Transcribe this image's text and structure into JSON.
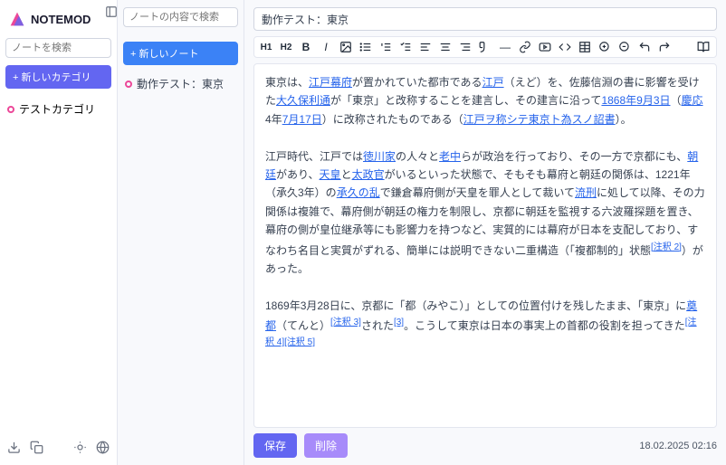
{
  "app": {
    "name": "NOTEMOD"
  },
  "sidebar": {
    "search_placeholder": "ノートを検索",
    "new_category": "+ 新しいカテゴリ",
    "categories": [
      {
        "label": "テストカテゴリ"
      }
    ]
  },
  "mid": {
    "search_placeholder": "ノートの内容で検索",
    "new_note": "+ 新しいノート",
    "notes": [
      {
        "label": "動作テスト：東京"
      }
    ]
  },
  "editor": {
    "title": "動作テスト：東京",
    "toolbar": {
      "h1": "H1",
      "h2": "H2"
    },
    "content_html": "東京は、<a href='#'>江戸幕府</a>が置かれていた都市である<a href='#'>江戸</a>（えど）を、佐藤信淵の書に影響を受けた<a href='#'>大久保利通</a>が「東京」と改称することを建言し、その建言に沿って<a href='#'>1868年</a><a href='#'>9月3日</a>（<a href='#'>慶応</a>4年<a href='#'>7月17日</a>）に改称されたものである（<a href='#'>江戸ヲ称シテ東京ト為スノ詔書</a>）。<br><br>江戸時代、江戸では<a href='#'>徳川家</a>の人々と<a href='#'>老中</a>らが政治を行っており、その一方で京都にも、<a href='#'>朝廷</a>があり、<a href='#'>天皇</a>と<a href='#'>太政官</a>がいるといった状態で、そもそも幕府と朝廷の関係は、1221年（承久3年）の<a href='#'>承久の乱</a>で鎌倉幕府側が天皇を罪人として裁いて<a href='#'>流刑</a>に処して以降、その力関係は複雑で、幕府側が朝廷の権力を制限し、京都に朝廷を監視する六波羅探題を置き、幕府の側が皇位継承等にも影響力を持つなど、実質的には幕府が日本を支配しており、すなわち名目と実質がずれる、簡単には説明できない二重構造（「複都制的」状態<span class='sup'>[注釈 2]</span>）があった。<br><br>1869年3月28日に、京都に「都（みやこ）」としての位置付けを残したまま、「東京」に<a href='#'>奠都</a>（てんと）<span class='sup'>[注釈 3]</span>された<span class='sup'>[3]</span>。こうして東京は日本の事実上の首都の役割を担ってきた<span class='sup'>[注釈 4]</span><span class='sup'>[注釈 5]</span>"
  },
  "footer": {
    "save": "保存",
    "delete": "削除",
    "timestamp": "18.02.2025 02:16"
  }
}
